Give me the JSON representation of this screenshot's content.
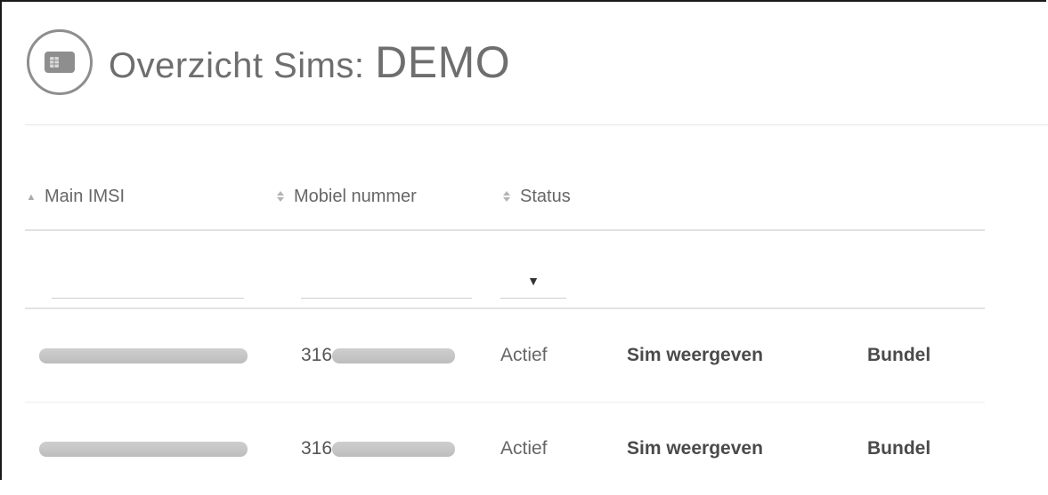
{
  "header": {
    "title_prefix": "Overzicht Sims: ",
    "title_name": "DEMO",
    "icon": "sim-card-icon"
  },
  "table": {
    "columns": [
      {
        "label": "Main IMSI",
        "sort_icon": "sort-ascending-icon"
      },
      {
        "label": "Mobiel nummer",
        "sort_icon": "sort-both-icon"
      },
      {
        "label": "Status",
        "sort_icon": "sort-both-icon"
      }
    ],
    "filters": {
      "imsi_value": "",
      "mobile_value": "",
      "status_selected": ""
    },
    "rows": [
      {
        "imsi_redacted": true,
        "mobile_prefix": "316",
        "mobile_redacted": true,
        "status": "Actief",
        "view_label": "Sim weergeven",
        "bundle_label": "Bundel"
      },
      {
        "imsi_redacted": true,
        "mobile_prefix": "316",
        "mobile_redacted": true,
        "status": "Actief",
        "view_label": "Sim weergeven",
        "bundle_label": "Bundel"
      }
    ]
  },
  "colors": {
    "text": "#555555",
    "title": "#6e6e6e",
    "divider": "#e2e2e2",
    "redaction": "#c6c6c6"
  }
}
